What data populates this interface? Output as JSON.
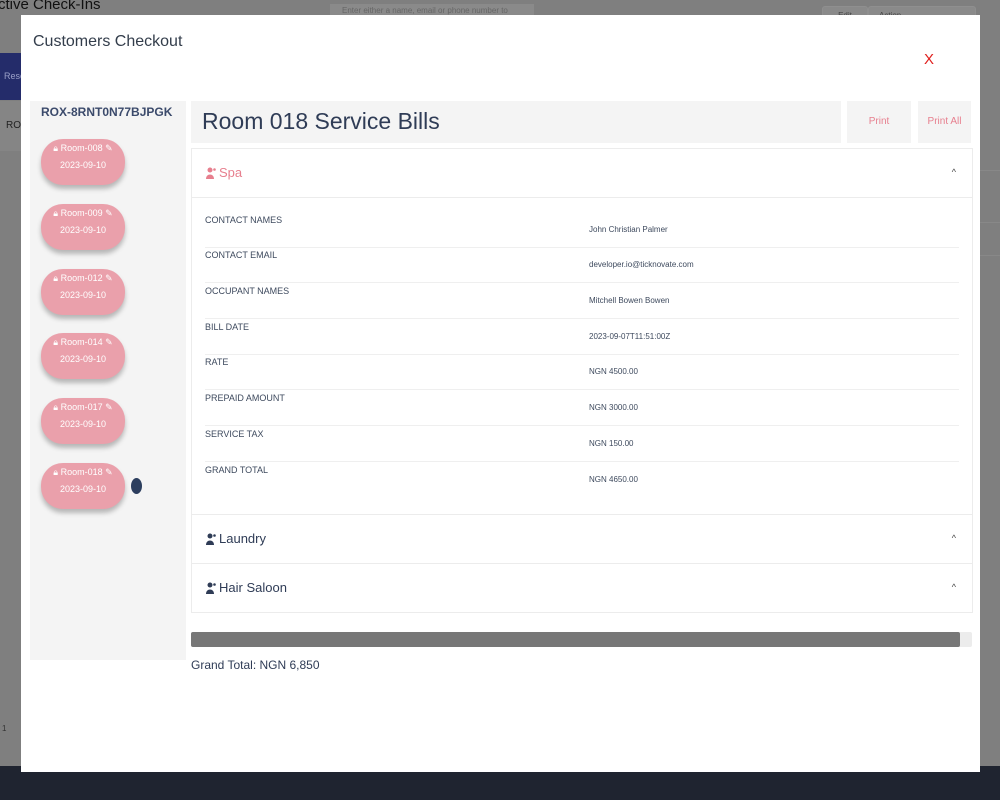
{
  "background": {
    "title": "ctive Check-Ins",
    "search_placeholder": "Enter either a name, email or phone number to sear",
    "btn_edit": "Edit",
    "btn_action": "Action",
    "tab_label": "Rese",
    "row_label": "ROX",
    "page_number": "1"
  },
  "modal": {
    "title": "Customers Checkout",
    "close_label": "X"
  },
  "sidebar": {
    "reservation_code": "ROX-8RNT0N77BJPGK",
    "rooms": [
      {
        "label": "Room-008",
        "date": "2023-09-10"
      },
      {
        "label": "Room-009",
        "date": "2023-09-10"
      },
      {
        "label": "Room-012",
        "date": "2023-09-10"
      },
      {
        "label": "Room-014",
        "date": "2023-09-10"
      },
      {
        "label": "Room-017",
        "date": "2023-09-10"
      },
      {
        "label": "Room-018",
        "date": "2023-09-10"
      }
    ],
    "active_room_index": 5
  },
  "bills": {
    "title": "Room 018 Service Bills",
    "print_label": "Print",
    "print_all_label": "Print All"
  },
  "services": {
    "spa": {
      "label": "Spa",
      "rows": [
        {
          "key": "CONTACT NAMES",
          "value": "John Christian Palmer"
        },
        {
          "key": "CONTACT EMAIL",
          "value": "developer.io@ticknovate.com"
        },
        {
          "key": "OCCUPANT NAMES",
          "value": "Mitchell Bowen Bowen"
        },
        {
          "key": "BILL DATE",
          "value": "2023-09-07T11:51:00Z"
        },
        {
          "key": "RATE",
          "value": "NGN 4500.00"
        },
        {
          "key": "PREPAID AMOUNT",
          "value": "NGN 3000.00"
        },
        {
          "key": "SERVICE TAX",
          "value": "NGN 150.00"
        },
        {
          "key": "GRAND TOTAL",
          "value": "NGN 4650.00"
        }
      ]
    },
    "laundry": {
      "label": "Laundry"
    },
    "hair_saloon": {
      "label": "Hair Saloon"
    },
    "chevron": "^"
  },
  "progress": {
    "fraction": 0.985
  },
  "footer": {
    "grand_total": "Grand Total: NGN 6,850"
  },
  "colors": {
    "accent_pink": "#e77f8e",
    "room_pill": "#eaa0ab",
    "close_red": "#e0201e",
    "heading_navy": "#2f3c56"
  }
}
